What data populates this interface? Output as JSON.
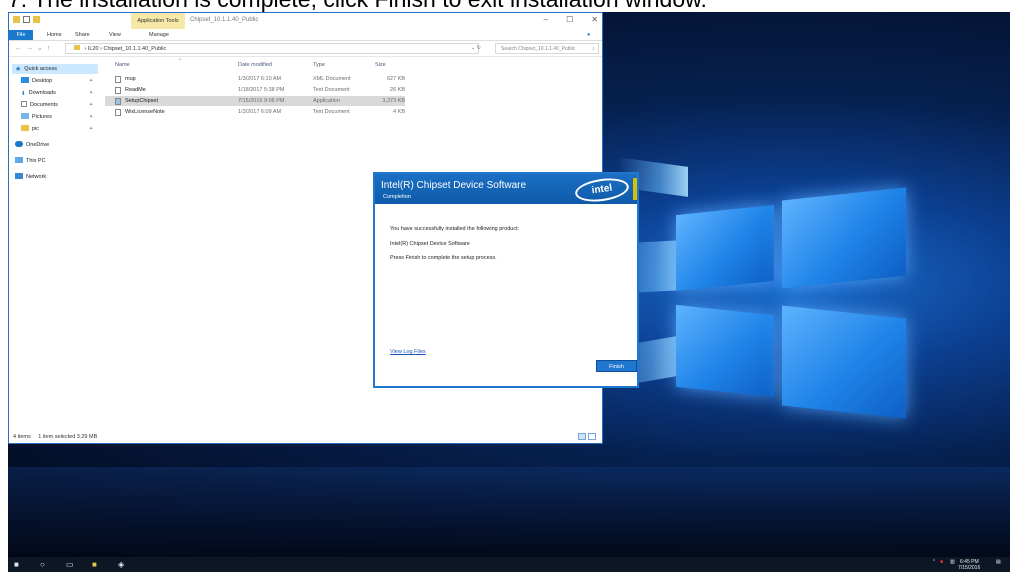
{
  "caption": {
    "text": "7. The installation is complete; click Finish to exit installation window."
  },
  "explorer": {
    "title": "Chipset_10.1.1.40_Public",
    "contextual_tab": "Application Tools",
    "ribbon_tabs": [
      "File",
      "Home",
      "Share",
      "View",
      "Manage"
    ],
    "address_root": "IL20",
    "address_folder": "Chipset_10.1.1.40_Public",
    "search_placeholder": "Search Chipset_10.1.1.40_Public",
    "columns": {
      "name": "Name",
      "date": "Date modified",
      "type": "Type",
      "size": "Size"
    },
    "nav": {
      "quick_access": "Quick access",
      "desktop": "Desktop",
      "downloads": "Downloads",
      "documents": "Documents",
      "pictures": "Pictures",
      "pic": "pic",
      "onedrive": "OneDrive",
      "this_pc": "This PC",
      "network": "Network"
    },
    "files": [
      {
        "name": "mup",
        "date": "1/3/2017 6:10 AM",
        "type": "XML Document",
        "size": "627 KB"
      },
      {
        "name": "ReadMe",
        "date": "1/18/2017 5:38 PM",
        "type": "Text Document",
        "size": "26 KB"
      },
      {
        "name": "SetupChipset",
        "date": "7/15/2016 9:06 PM",
        "type": "Application",
        "size": "3,373 KB"
      },
      {
        "name": "WixLicenseNote",
        "date": "1/3/2017 6:09 AM",
        "type": "Text Document",
        "size": "4 KB"
      }
    ],
    "status_items": "4 items",
    "status_selected": "1 item selected  3.29 MB"
  },
  "dialog": {
    "title": "Intel(R) Chipset Device Software",
    "subtitle": "Completion",
    "logo_text": "intel",
    "line1": "You have successfully installed the following product:",
    "line2": "Intel(R) Chipset Device Software",
    "line3": "Press Finish to complete the setup process.",
    "log_link": "View Log Files",
    "finish_label": "Finish"
  },
  "taskbar": {
    "time": "6:45 PM",
    "date": "7/15/2016"
  },
  "colors": {
    "accent": "#1f77d0",
    "contextual_tab": "#f6e9a8",
    "wallpaper": "#0c3f90"
  }
}
